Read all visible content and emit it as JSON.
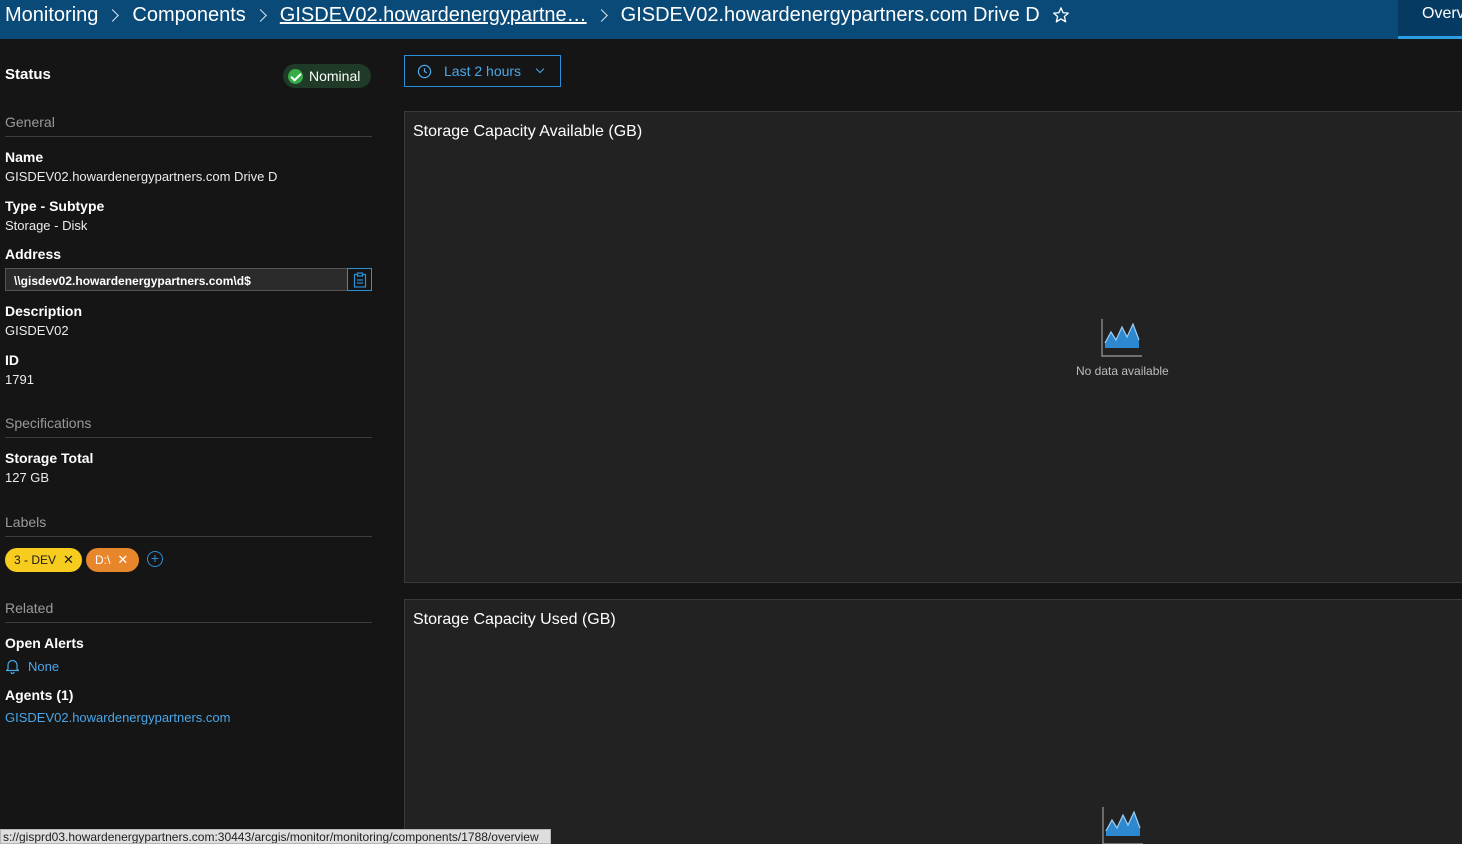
{
  "breadcrumb": {
    "items": [
      "Monitoring",
      "Components",
      "GISDEV02.howardenergypartne…",
      "GISDEV02.howardenergypartners.com Drive D"
    ]
  },
  "tabs": {
    "overview": "Overv"
  },
  "status": {
    "label": "Status",
    "value": "Nominal",
    "color": "#35ac46"
  },
  "general": {
    "title": "General",
    "name_label": "Name",
    "name_value": "GISDEV02.howardenergypartners.com Drive D",
    "type_label": "Type - Subtype",
    "type_value": "Storage - Disk",
    "address_label": "Address",
    "address_value": "\\\\gisdev02.howardenergypartners.com\\d$",
    "description_label": "Description",
    "description_value": "GISDEV02",
    "id_label": "ID",
    "id_value": "1791"
  },
  "specifications": {
    "title": "Specifications",
    "storage_label": "Storage Total",
    "storage_value": "127 GB"
  },
  "labels": {
    "title": "Labels",
    "items": [
      {
        "text": "3 - DEV",
        "color": "#f6cc1e"
      },
      {
        "text": "D:\\",
        "color": "#e8862c"
      }
    ]
  },
  "related": {
    "title": "Related",
    "alerts_label": "Open Alerts",
    "alerts_value": "None",
    "agents_label": "Agents (1)",
    "agent_link": "GISDEV02.howardenergypartners.com"
  },
  "timerange": {
    "label": "Last 2 hours"
  },
  "charts": [
    {
      "title": "Storage Capacity Available (GB)",
      "empty_text": "No data available"
    },
    {
      "title": "Storage Capacity Used (GB)"
    }
  ],
  "statusbar": {
    "url": "s://gisprd03.howardenergypartners.com:30443/arcgis/monitor/monitoring/components/1788/overview"
  },
  "colors": {
    "header": "#0a4a78",
    "accent": "#2b9ee3",
    "link": "#4aa7e8"
  }
}
